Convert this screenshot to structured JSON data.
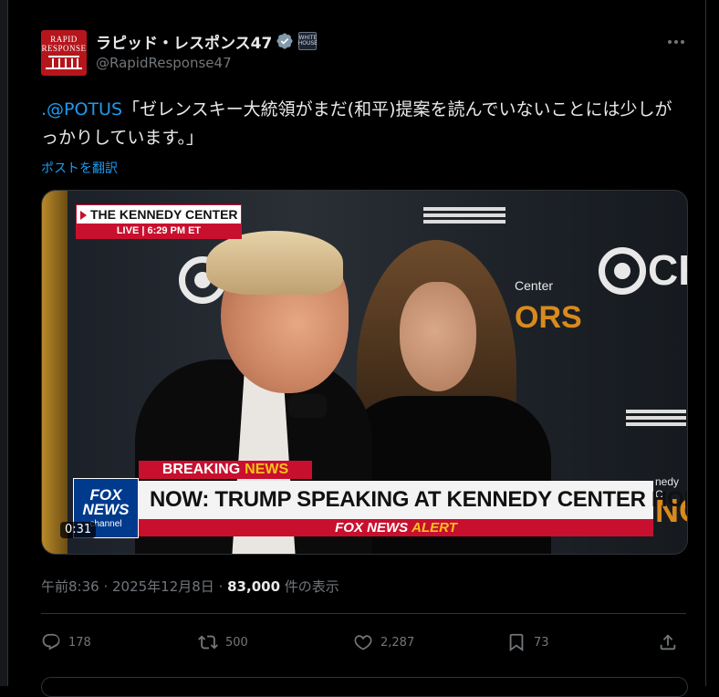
{
  "author": {
    "avatar_text": "RAPID RESPONSE",
    "display_name": "ラピッド・レスポンス47",
    "handle": "@RapidResponse47",
    "gov_badge_text": "WHITE HOUSE"
  },
  "post": {
    "mention": ".@POTUS",
    "body": "「ゼレンスキー大統領がまだ(和平)提案を読んでいないことには少しがっかりしています。」",
    "translate_label": "ポストを翻訳"
  },
  "media": {
    "tag_top": "THE KENNEDY CENTER",
    "tag_live": "LIVE  |  6:29 PM ET",
    "breaking_1": "BREAKING",
    "breaking_2": "NEWS",
    "headline": "NOW: TRUMP SPEAKING AT KENNEDY CENTER HONORS",
    "alert_1": "FOX NEWS",
    "alert_2": "ALERT",
    "fox_1": "FOX",
    "fox_2": "NEWS",
    "fox_3": "channel",
    "bg_logo_text": "CBS",
    "bg_honors": "ORS",
    "bg_center": "Center",
    "bg_right": "nedy C",
    "bg_nof": "NOF",
    "timer": "0:31"
  },
  "meta": {
    "time": "午前8:36",
    "sep": " · ",
    "date": "2025年12月8日",
    "views": "83,000",
    "views_label": " 件の表示"
  },
  "actions": {
    "replies": "178",
    "reposts": "500",
    "likes": "2,287",
    "bookmarks": "73"
  },
  "colors": {
    "accent": "#1d9bf0",
    "muted": "#71767b",
    "text": "#e7e9ea",
    "fox_red": "#c8102e",
    "fox_yellow": "#f6c21a"
  },
  "icons": [
    "verified-icon",
    "gov-badge-icon",
    "more-icon",
    "reply-icon",
    "repost-icon",
    "like-icon",
    "bookmark-icon",
    "share-icon"
  ]
}
